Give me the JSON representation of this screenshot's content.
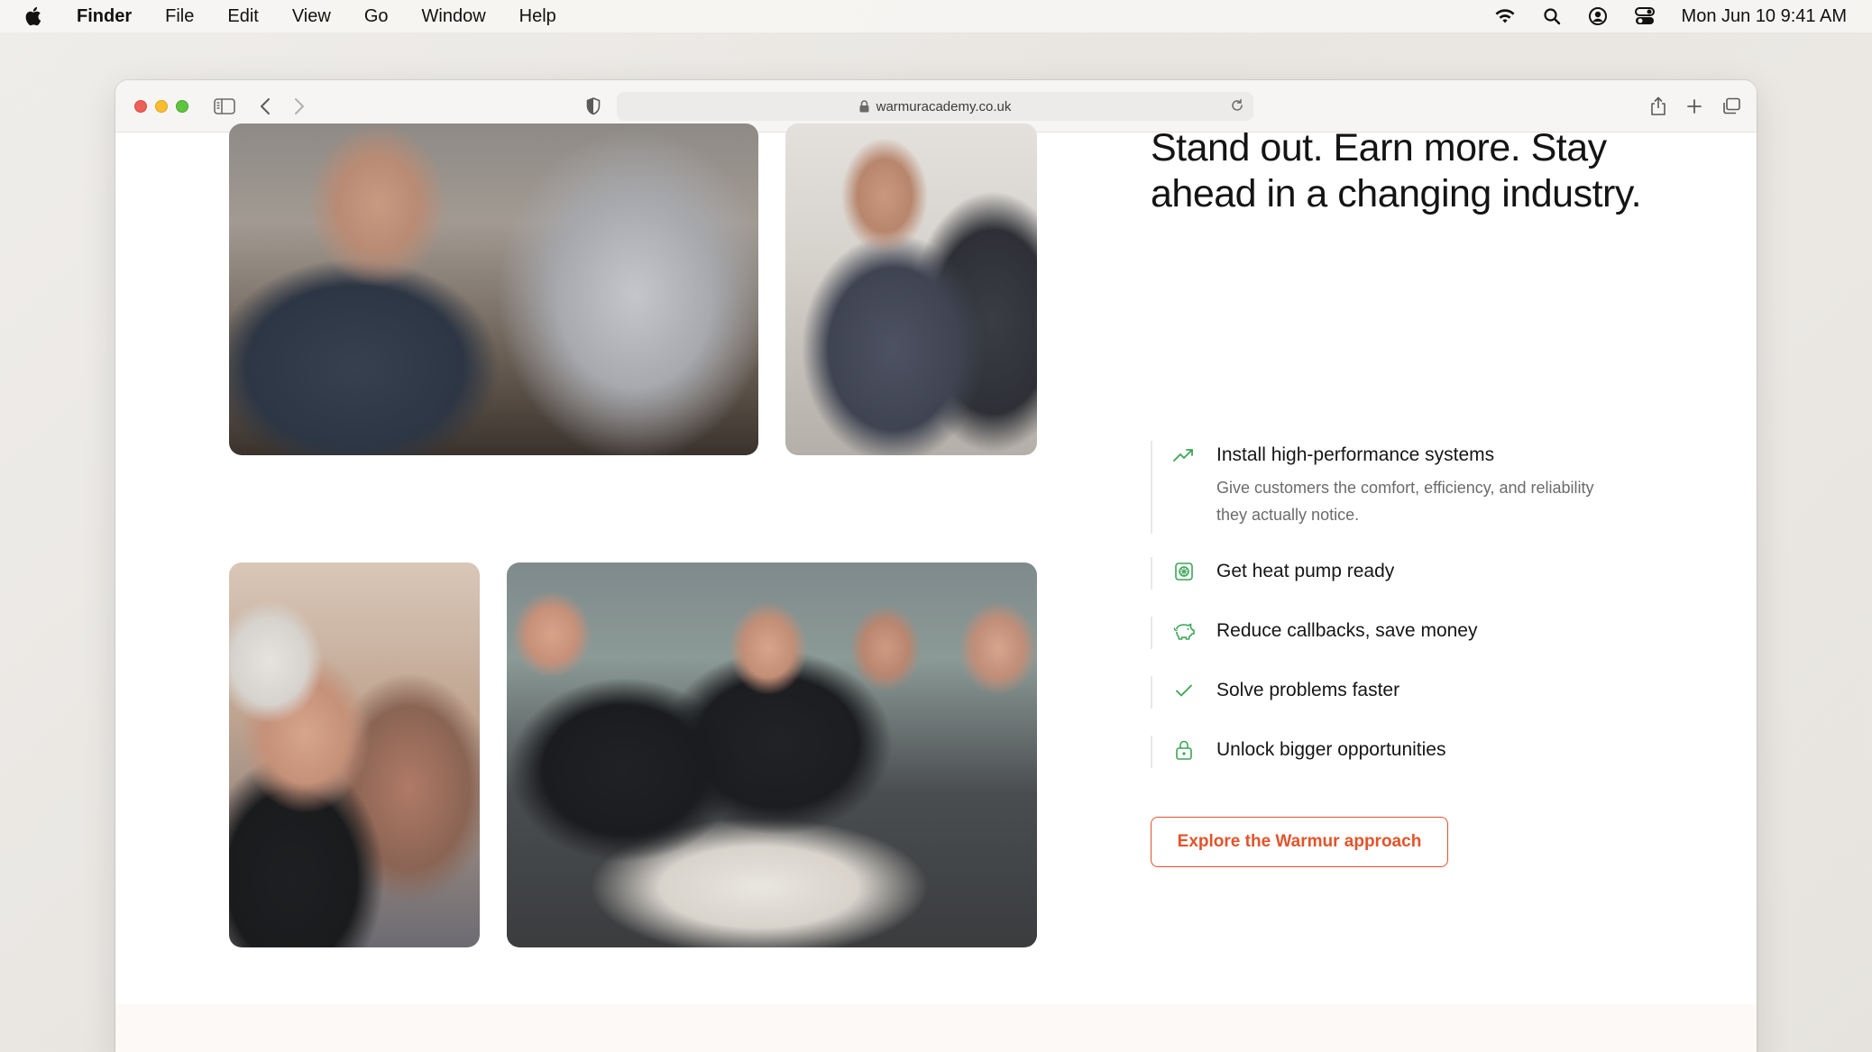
{
  "menubar": {
    "app_name": "Finder",
    "menus": [
      "File",
      "Edit",
      "View",
      "Go",
      "Window",
      "Help"
    ],
    "clock": "Mon Jun 10  9:41 AM",
    "status_icons": [
      "wifi-icon",
      "search-icon",
      "user-icon",
      "control-center-icon"
    ]
  },
  "browser": {
    "url": "warmuracademy.co.uk"
  },
  "hero": {
    "headline": "Stand out. Earn more. Stay ahead in a changing industry."
  },
  "features": [
    {
      "title": "Install high-performance systems",
      "description": "Give customers the comfort, efficiency, and reliability they actually notice.",
      "icon": "trend-up-icon"
    },
    {
      "title": "Get heat pump ready",
      "icon": "heat-pump-icon"
    },
    {
      "title": "Reduce callbacks, save money",
      "icon": "piggy-bank-icon"
    },
    {
      "title": "Solve problems faster",
      "icon": "check-icon"
    },
    {
      "title": "Unlock bigger opportunities",
      "icon": "lock-icon"
    }
  ],
  "cta": {
    "label": "Explore the Warmur approach"
  },
  "colors": {
    "accent": "#e2542b",
    "icon_green": "#3aa655"
  }
}
